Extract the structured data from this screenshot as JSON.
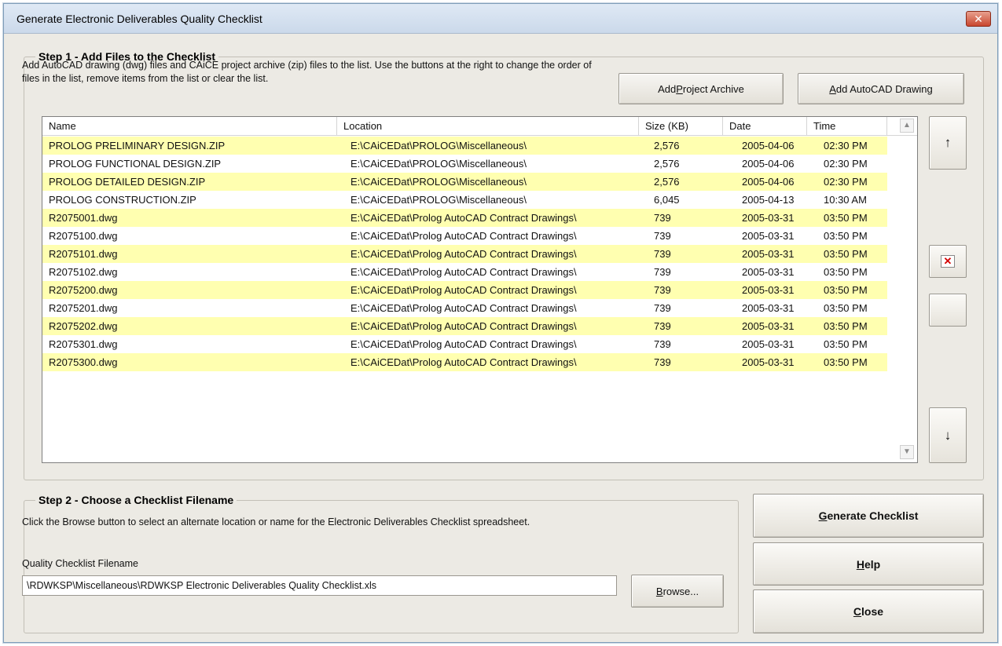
{
  "window": {
    "title": "Generate Electronic Deliverables Quality Checklist",
    "close_glyph": "✕"
  },
  "step1": {
    "legend": "Step 1 - Add Files to the Checklist",
    "description": "Add AutoCAD drawing (dwg) files and CAiCE project archive (zip) files to the list. Use the buttons at the right to change the order of files in the list, remove items from the list or clear the list.",
    "add_project_archive_prefix": "Add ",
    "add_project_archive_accel": "P",
    "add_project_archive_suffix": "roject Archive",
    "add_autocad_drawing_accel": "A",
    "add_autocad_drawing_suffix": "dd AutoCAD Drawing",
    "columns": [
      "Name",
      "Location",
      "Size (KB)",
      "Date",
      "Time"
    ],
    "rows": [
      {
        "name": "PROLOG PRELIMINARY DESIGN.ZIP",
        "location": "E:\\CAiCEDat\\PROLOG\\Miscellaneous\\",
        "size": "2,576",
        "date": "2005-04-06",
        "time": "02:30 PM"
      },
      {
        "name": "PROLOG FUNCTIONAL DESIGN.ZIP",
        "location": "E:\\CAiCEDat\\PROLOG\\Miscellaneous\\",
        "size": "2,576",
        "date": "2005-04-06",
        "time": "02:30 PM"
      },
      {
        "name": "PROLOG DETAILED DESIGN.ZIP",
        "location": "E:\\CAiCEDat\\PROLOG\\Miscellaneous\\",
        "size": "2,576",
        "date": "2005-04-06",
        "time": "02:30 PM"
      },
      {
        "name": "PROLOG CONSTRUCTION.ZIP",
        "location": "E:\\CAiCEDat\\PROLOG\\Miscellaneous\\",
        "size": "6,045",
        "date": "2005-04-13",
        "time": "10:30 AM"
      },
      {
        "name": "R2075001.dwg",
        "location": "E:\\CAiCEDat\\Prolog AutoCAD Contract Drawings\\",
        "size": "739",
        "date": "2005-03-31",
        "time": "03:50 PM"
      },
      {
        "name": "R2075100.dwg",
        "location": "E:\\CAiCEDat\\Prolog AutoCAD Contract Drawings\\",
        "size": "739",
        "date": "2005-03-31",
        "time": "03:50 PM"
      },
      {
        "name": "R2075101.dwg",
        "location": "E:\\CAiCEDat\\Prolog AutoCAD Contract Drawings\\",
        "size": "739",
        "date": "2005-03-31",
        "time": "03:50 PM"
      },
      {
        "name": "R2075102.dwg",
        "location": "E:\\CAiCEDat\\Prolog AutoCAD Contract Drawings\\",
        "size": "739",
        "date": "2005-03-31",
        "time": "03:50 PM"
      },
      {
        "name": "R2075200.dwg",
        "location": "E:\\CAiCEDat\\Prolog AutoCAD Contract Drawings\\",
        "size": "739",
        "date": "2005-03-31",
        "time": "03:50 PM"
      },
      {
        "name": "R2075201.dwg",
        "location": "E:\\CAiCEDat\\Prolog AutoCAD Contract Drawings\\",
        "size": "739",
        "date": "2005-03-31",
        "time": "03:50 PM"
      },
      {
        "name": "R2075202.dwg",
        "location": "E:\\CAiCEDat\\Prolog AutoCAD Contract Drawings\\",
        "size": "739",
        "date": "2005-03-31",
        "time": "03:50 PM"
      },
      {
        "name": "R2075301.dwg",
        "location": "E:\\CAiCEDat\\Prolog AutoCAD Contract Drawings\\",
        "size": "739",
        "date": "2005-03-31",
        "time": "03:50 PM"
      },
      {
        "name": "R2075300.dwg",
        "location": "E:\\CAiCEDat\\Prolog AutoCAD Contract Drawings\\",
        "size": "739",
        "date": "2005-03-31",
        "time": "03:50 PM"
      }
    ],
    "row_highlight_color": "#ffffb0",
    "move_up_glyph": "↑",
    "remove_glyph": "✕",
    "move_down_glyph": "↓"
  },
  "step2": {
    "legend": "Step 2 - Choose a Checklist Filename",
    "description": "Click the Browse button to select an alternate location or name for the Electronic Deliverables Checklist spreadsheet.",
    "filename_label": "Quality Checklist Filename",
    "filename_value": "\\RDWKSP\\Miscellaneous\\RDWKSP Electronic Deliverables Quality Checklist.xls",
    "browse_accel": "B",
    "browse_suffix": "rowse..."
  },
  "actions": {
    "generate_accel": "G",
    "generate_suffix": "enerate Checklist",
    "help_accel": "H",
    "help_suffix": "elp",
    "close_accel": "C",
    "close_suffix": "lose"
  }
}
